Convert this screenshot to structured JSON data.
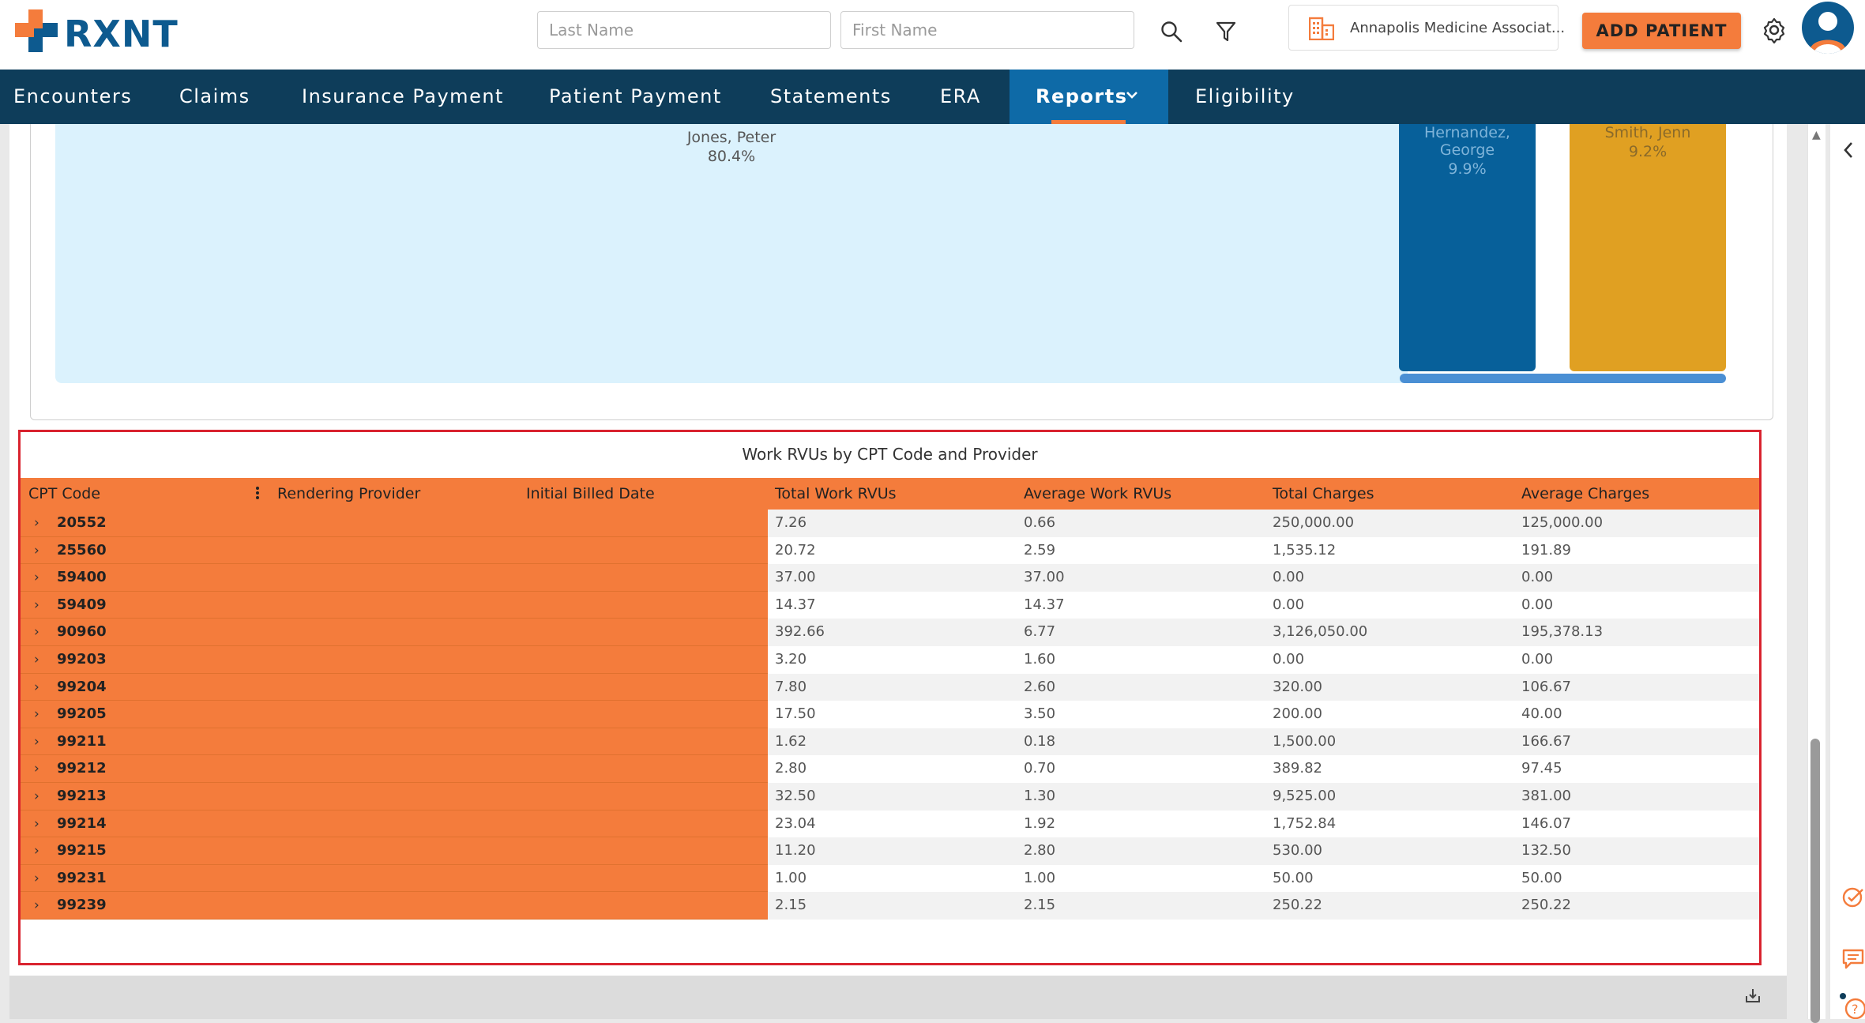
{
  "app": {
    "logo_text": "RXNT",
    "search": {
      "last_name_placeholder": "Last Name",
      "first_name_placeholder": "First Name"
    },
    "practice_name": "Annapolis Medicine Associat...",
    "add_patient_label": "ADD PATIENT"
  },
  "colors": {
    "accent": "#f47c3c",
    "nav_bg": "#0e3d5a",
    "nav_active": "#0e6aa7",
    "brand_blue": "#0d5a8f",
    "highlight_border": "#d9232f"
  },
  "icons": {
    "search": "search-icon",
    "filter": "filter-icon",
    "practice": "building-icon",
    "settings": "gear-icon",
    "avatar": "user-avatar-icon",
    "chevron": "chevron-right-icon",
    "download": "download-icon",
    "check": "check-circle-icon",
    "chat": "chat-icon",
    "help": "help-icon"
  },
  "nav": {
    "items": [
      "Encounters",
      "Claims",
      "Insurance Payment",
      "Patient Payment",
      "Statements",
      "ERA",
      "Reports",
      "Eligibility"
    ],
    "active": "Reports"
  },
  "treemap": {
    "tiles": [
      {
        "label": "Jones, Peter",
        "percent": "80.4%",
        "color": "#dbf2fd",
        "text_color": "#555555"
      },
      {
        "label": "Hernandez, George",
        "percent": "9.9%",
        "color": "#07609a",
        "text_color": "#7fb4d9"
      },
      {
        "label": "Smith, Jenn",
        "percent": "9.2%",
        "color": "#e0a022",
        "text_color": "#8a6a2a"
      }
    ]
  },
  "table": {
    "title": "Work RVUs by CPT Code and Provider",
    "columns": [
      "CPT Code",
      "Rendering Provider",
      "Initial Billed Date",
      "Total Work RVUs",
      "Average Work RVUs",
      "Total Charges",
      "Average Charges"
    ],
    "rows": [
      {
        "code": "20552",
        "total_rvu": "7.26",
        "avg_rvu": "0.66",
        "total_charges": "250,000.00",
        "avg_charges": "125,000.00"
      },
      {
        "code": "25560",
        "total_rvu": "20.72",
        "avg_rvu": "2.59",
        "total_charges": "1,535.12",
        "avg_charges": "191.89"
      },
      {
        "code": "59400",
        "total_rvu": "37.00",
        "avg_rvu": "37.00",
        "total_charges": "0.00",
        "avg_charges": "0.00"
      },
      {
        "code": "59409",
        "total_rvu": "14.37",
        "avg_rvu": "14.37",
        "total_charges": "0.00",
        "avg_charges": "0.00"
      },
      {
        "code": "90960",
        "total_rvu": "392.66",
        "avg_rvu": "6.77",
        "total_charges": "3,126,050.00",
        "avg_charges": "195,378.13"
      },
      {
        "code": "99203",
        "total_rvu": "3.20",
        "avg_rvu": "1.60",
        "total_charges": "0.00",
        "avg_charges": "0.00"
      },
      {
        "code": "99204",
        "total_rvu": "7.80",
        "avg_rvu": "2.60",
        "total_charges": "320.00",
        "avg_charges": "106.67"
      },
      {
        "code": "99205",
        "total_rvu": "17.50",
        "avg_rvu": "3.50",
        "total_charges": "200.00",
        "avg_charges": "40.00"
      },
      {
        "code": "99211",
        "total_rvu": "1.62",
        "avg_rvu": "0.18",
        "total_charges": "1,500.00",
        "avg_charges": "166.67"
      },
      {
        "code": "99212",
        "total_rvu": "2.80",
        "avg_rvu": "0.70",
        "total_charges": "389.82",
        "avg_charges": "97.45"
      },
      {
        "code": "99213",
        "total_rvu": "32.50",
        "avg_rvu": "1.30",
        "total_charges": "9,525.00",
        "avg_charges": "381.00"
      },
      {
        "code": "99214",
        "total_rvu": "23.04",
        "avg_rvu": "1.92",
        "total_charges": "1,752.84",
        "avg_charges": "146.07"
      },
      {
        "code": "99215",
        "total_rvu": "11.20",
        "avg_rvu": "2.80",
        "total_charges": "530.00",
        "avg_charges": "132.50"
      },
      {
        "code": "99231",
        "total_rvu": "1.00",
        "avg_rvu": "1.00",
        "total_charges": "50.00",
        "avg_charges": "50.00"
      },
      {
        "code": "99239",
        "total_rvu": "2.15",
        "avg_rvu": "2.15",
        "total_charges": "250.22",
        "avg_charges": "250.22"
      }
    ]
  }
}
